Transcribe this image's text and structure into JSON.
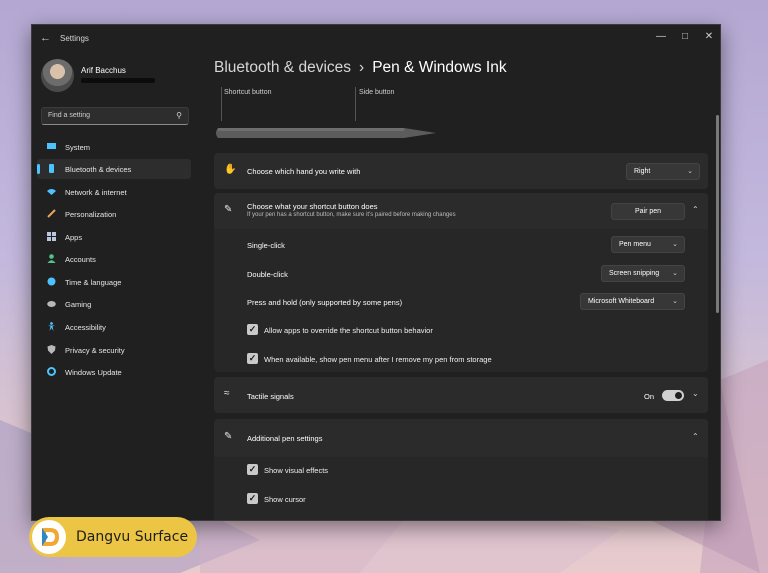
{
  "window": {
    "title": "Settings"
  },
  "user": {
    "name": "Arif Bacchus"
  },
  "search": {
    "placeholder": "Find a setting"
  },
  "sidebar": {
    "items": [
      {
        "label": "System",
        "icon": "display-icon",
        "color": "#4cc2ff"
      },
      {
        "label": "Bluetooth & devices",
        "icon": "bluetooth-icon",
        "color": "#4cc2ff",
        "active": true
      },
      {
        "label": "Network & internet",
        "icon": "wifi-icon",
        "color": "#4cc2ff"
      },
      {
        "label": "Personalization",
        "icon": "brush-icon",
        "color": "#e6a45a"
      },
      {
        "label": "Apps",
        "icon": "apps-icon",
        "color": "#b9c7e0"
      },
      {
        "label": "Accounts",
        "icon": "person-icon",
        "color": "#53c18a"
      },
      {
        "label": "Time & language",
        "icon": "globe-clock-icon",
        "color": "#4cc2ff"
      },
      {
        "label": "Gaming",
        "icon": "gamepad-icon",
        "color": "#b8b8b8"
      },
      {
        "label": "Accessibility",
        "icon": "accessibility-icon",
        "color": "#4cc2ff"
      },
      {
        "label": "Privacy & security",
        "icon": "shield-icon",
        "color": "#b8b8b8"
      },
      {
        "label": "Windows Update",
        "icon": "update-icon",
        "color": "#4cc2ff"
      }
    ]
  },
  "breadcrumb": {
    "parent": "Bluetooth & devices",
    "separator": "›",
    "current": "Pen & Windows Ink"
  },
  "pen": {
    "shortcut_label": "Shortcut button",
    "side_label": "Side button"
  },
  "hand": {
    "label": "Choose which hand you write with",
    "value": "Right"
  },
  "shortcut": {
    "title": "Choose what your shortcut button does",
    "subtitle": "If your pen has a shortcut button, make sure it's paired before making changes",
    "pair_button": "Pair pen",
    "rows": [
      {
        "label": "Single-click",
        "value": "Pen menu"
      },
      {
        "label": "Double-click",
        "value": "Screen snipping"
      },
      {
        "label": "Press and hold (only supported by some pens)",
        "value": "Microsoft Whiteboard"
      }
    ],
    "checks": [
      {
        "label": "Allow apps to override the shortcut button behavior",
        "checked": true
      },
      {
        "label": "When available, show pen menu after I remove my pen from storage",
        "checked": true
      }
    ]
  },
  "tactile": {
    "label": "Tactile signals",
    "state": "On",
    "enabled": true
  },
  "additional": {
    "label": "Additional pen settings",
    "checks": [
      {
        "label": "Show visual effects",
        "checked": true
      },
      {
        "label": "Show cursor",
        "checked": true
      }
    ]
  },
  "brand": {
    "name": "Dangvu Surface",
    "color": "#ecc544"
  },
  "accent": "#4cc2ff"
}
